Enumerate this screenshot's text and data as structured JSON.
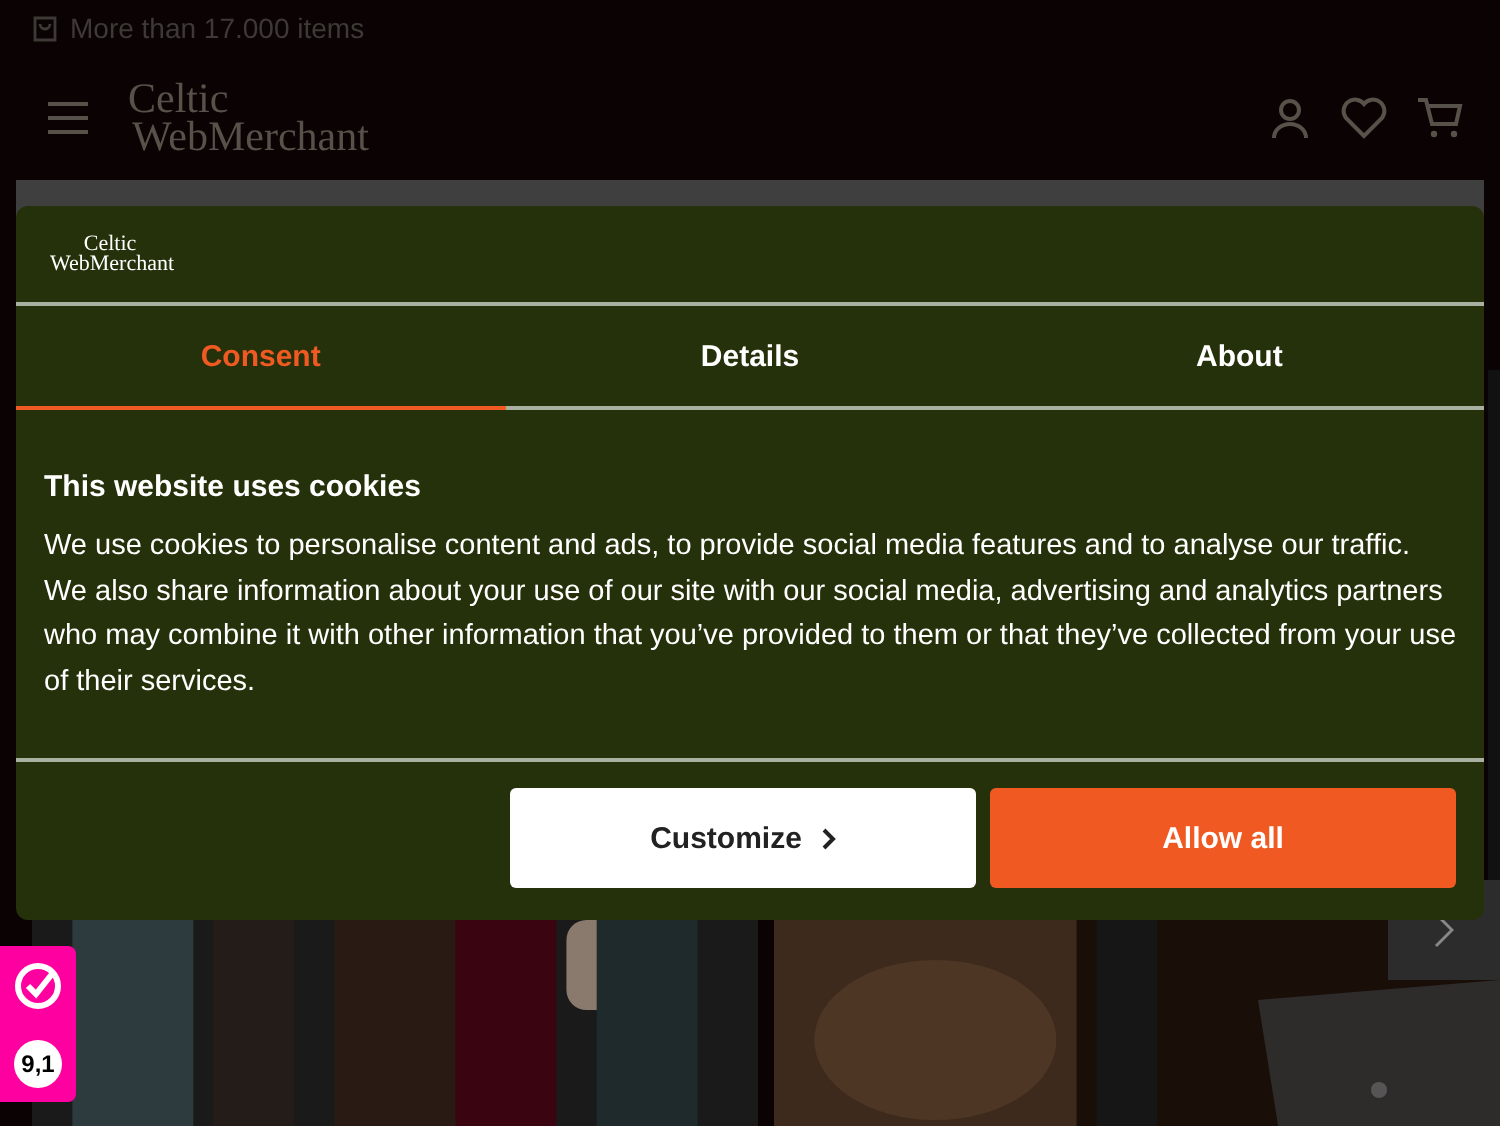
{
  "topbar": {
    "text": "More than 17.000 items"
  },
  "header": {
    "logo": [
      "Celtic",
      "WebMerchant"
    ]
  },
  "consent": {
    "logo": [
      "Celtic",
      "WebMerchant"
    ],
    "tabs": [
      {
        "label": "Consent",
        "selected": true
      },
      {
        "label": "Details",
        "selected": false
      },
      {
        "label": "About",
        "selected": false
      }
    ],
    "title": "This website uses cookies",
    "body": "We use cookies to personalise content and ads, to provide social media features and to analyse our traffic. We also share information about your use of our site with our social media, advertising and analytics partners who may combine it with other information that you’ve provided to them or that they’ve collected from your use of their services.",
    "buttons": [
      {
        "label": "Customize",
        "kind": "secondary"
      },
      {
        "label": "Allow all",
        "kind": "primary"
      }
    ]
  },
  "trust_badge": {
    "score": "9,1"
  }
}
